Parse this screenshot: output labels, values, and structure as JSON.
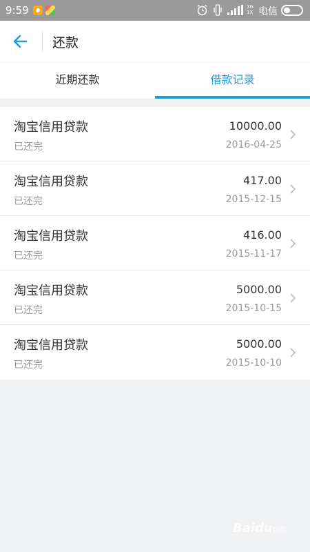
{
  "status_bar": {
    "time": "9:59",
    "network": "3G",
    "network_sub": "1X",
    "carrier": "电信",
    "icons": [
      "app-icon",
      "gallery-icon",
      "alarm-icon",
      "vibrate-icon",
      "signal-icon",
      "battery-icon"
    ]
  },
  "header": {
    "back_icon": "back-arrow-icon",
    "title": "还款"
  },
  "tabs": [
    {
      "label": "近期还款",
      "active": false
    },
    {
      "label": "借款记录",
      "active": true
    }
  ],
  "colors": {
    "accent": "#1c9ee0",
    "status_bar": "#9a9a9a",
    "background": "#f0f1f3"
  },
  "records": [
    {
      "title": "淘宝信用贷款",
      "status": "已还完",
      "amount": "10000.00",
      "date": "2016-04-25"
    },
    {
      "title": "淘宝信用贷款",
      "status": "已还完",
      "amount": "417.00",
      "date": "2015-12-15"
    },
    {
      "title": "淘宝信用贷款",
      "status": "已还完",
      "amount": "416.00",
      "date": "2015-11-17"
    },
    {
      "title": "淘宝信用贷款",
      "status": "已还完",
      "amount": "5000.00",
      "date": "2015-10-15"
    },
    {
      "title": "淘宝信用贷款",
      "status": "已还完",
      "amount": "5000.00",
      "date": "2015-10-10"
    }
  ],
  "watermark": {
    "main": "Baidu",
    "sub": "经验"
  }
}
